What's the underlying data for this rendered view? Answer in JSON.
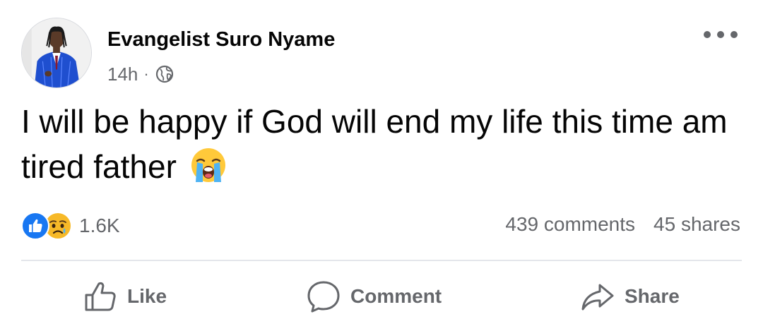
{
  "post": {
    "author": "Evangelist Suro Nyame",
    "time": "14h",
    "separator": "·",
    "audience_icon": "globe-icon",
    "text": "I will be happy if God will end my life this time am tired father",
    "text_emoji": "loudly-crying-face-emoji"
  },
  "reactions": {
    "icons": [
      "like-reaction-icon",
      "sad-reaction-icon"
    ],
    "count": "1.6K",
    "comments": "439 comments",
    "shares": "45 shares"
  },
  "actions": {
    "like": "Like",
    "comment": "Comment",
    "share": "Share"
  },
  "colors": {
    "primary_text": "#050505",
    "secondary_text": "#65676b",
    "like_blue": "#1877f2",
    "sad_yellow": "#f7b928",
    "divider": "#e4e6eb"
  }
}
